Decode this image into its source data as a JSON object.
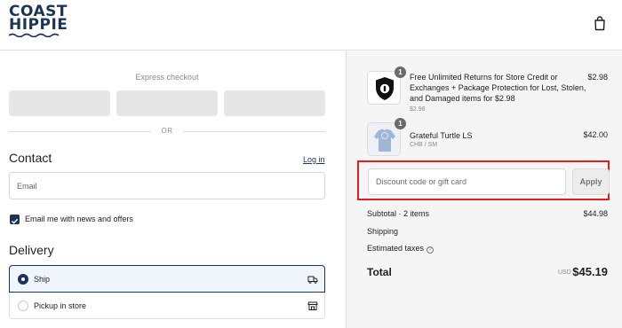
{
  "brand": {
    "line1": "COAST",
    "line2": "HIPPIE",
    "color": "#1c3557"
  },
  "header": {
    "cart_icon": "shopping-bag-icon"
  },
  "express": {
    "title": "Express checkout",
    "or_label": "OR"
  },
  "contact": {
    "heading": "Contact",
    "login_label": "Log in",
    "email_placeholder": "Email",
    "newsletter_label": "Email me with news and offers"
  },
  "delivery": {
    "heading": "Delivery",
    "options": [
      {
        "label": "Ship",
        "icon": "truck-icon",
        "selected": true
      },
      {
        "label": "Pickup in store",
        "icon": "store-icon",
        "selected": false
      }
    ]
  },
  "order": {
    "items": [
      {
        "qty": "1",
        "title_lines": [
          "Free Unlimited Returns for Store Credit or",
          "Exchanges + Package Protection for Lost, Stolen,",
          "and Damaged items for $2.98"
        ],
        "sub": "$2.98",
        "price": "$2.98",
        "icon": "shield-lock-icon"
      },
      {
        "qty": "1",
        "title_lines": [
          "Grateful Turtle LS"
        ],
        "sub": "CHB / SM",
        "price": "$42.00",
        "icon": "shirt-icon"
      }
    ],
    "discount": {
      "placeholder": "Discount code or gift card",
      "apply_label": "Apply"
    },
    "summary": {
      "subtotal_label": "Subtotal · 2 items",
      "subtotal_value": "$44.98",
      "shipping_label": "Shipping",
      "taxes_label": "Estimated taxes",
      "total_label": "Total",
      "currency": "USD",
      "total_value": "$45.19"
    }
  },
  "colors": {
    "accent": "#1c3557",
    "highlight_border": "#e11d1d",
    "sidebar_bg": "#f5f5f5"
  }
}
